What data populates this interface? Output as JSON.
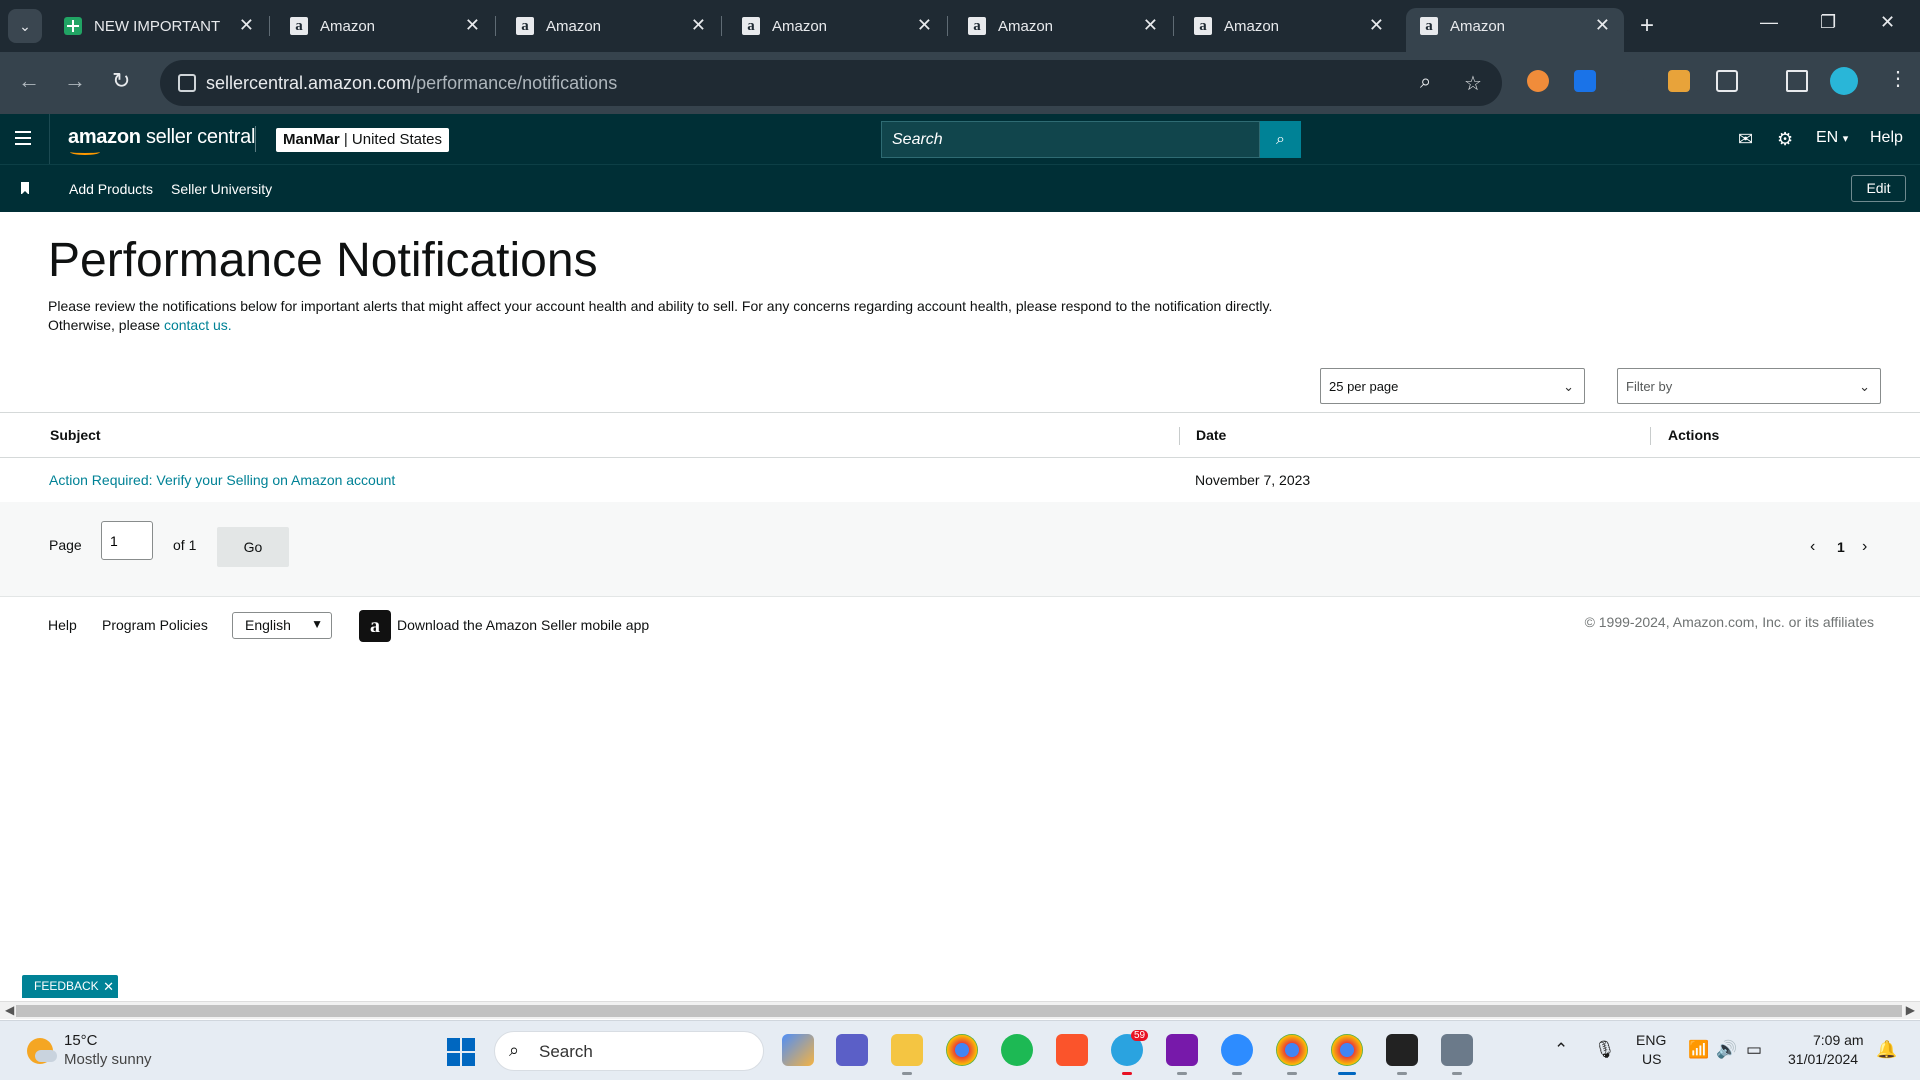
{
  "browser": {
    "tabs": [
      {
        "title": "NEW IMPORTANT SH",
        "favicon": "sheets-icon"
      },
      {
        "title": "Amazon",
        "favicon": "amazon-icon"
      },
      {
        "title": "Amazon",
        "favicon": "amazon-icon"
      },
      {
        "title": "Amazon",
        "favicon": "amazon-icon"
      },
      {
        "title": "Amazon",
        "favicon": "amazon-icon"
      },
      {
        "title": "Amazon",
        "favicon": "amazon-icon"
      },
      {
        "title": "Amazon",
        "favicon": "amazon-icon",
        "active": true
      }
    ],
    "url_domain": "sellercentral.amazon.com",
    "url_path": "/performance/notifications"
  },
  "header": {
    "logo_brand": "amazon",
    "logo_product": "seller central",
    "account_name": "ManMar",
    "account_marketplace": "United States",
    "search_placeholder": "Search",
    "language": "EN",
    "help": "Help"
  },
  "bookmarks": {
    "items": [
      "Add Products",
      "Seller University"
    ],
    "edit_label": "Edit"
  },
  "main": {
    "title": "Performance Notifications",
    "intro_line1": "Please review the notifications below for important alerts that might affect your account health and ability to sell. For any concerns regarding account health, please respond to the notification directly.",
    "intro_line2_prefix": "Otherwise, please",
    "intro_link": "contact us.",
    "per_page": "25 per page",
    "filter_placeholder": "Filter by"
  },
  "table": {
    "columns": [
      "Subject",
      "Date",
      "Actions"
    ],
    "rows": [
      {
        "subject": "Action Required: Verify your Selling on Amazon account",
        "date": "November 7, 2023",
        "actions": ""
      }
    ]
  },
  "pagination": {
    "page_label": "Page",
    "current_page": "1",
    "of_label": "of 1",
    "go_label": "Go",
    "page_number": "1"
  },
  "footer": {
    "help": "Help",
    "program_policies": "Program Policies",
    "language": "English",
    "app_text": "Download the Amazon Seller mobile app",
    "copyright": "© 1999-2024, Amazon.com, Inc. or its affiliates"
  },
  "feedback": {
    "label": "FEEDBACK"
  },
  "taskbar": {
    "temperature": "15°C",
    "weather": "Mostly sunny",
    "search_placeholder": "Search",
    "telegram_badge": "59",
    "lang_top": "ENG",
    "lang_bottom": "US",
    "time": "7:09 am",
    "date": "31/01/2024"
  },
  "colors": {
    "header_bg": "#002f36",
    "accent": "#008296",
    "browser_bg": "#1f2a33"
  }
}
